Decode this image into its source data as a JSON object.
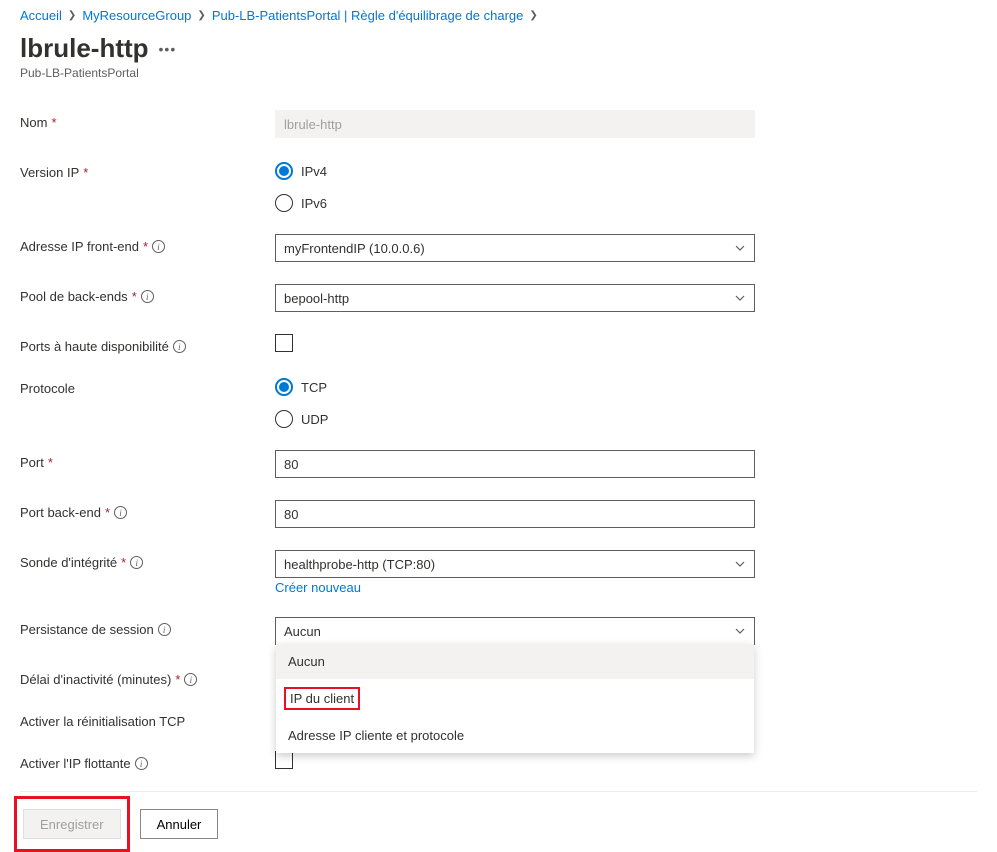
{
  "breadcrumb": {
    "items": [
      "Accueil",
      "MyResourceGroup",
      "Pub-LB-PatientsPortal | Règle d'équilibrage de charge"
    ]
  },
  "header": {
    "title": "lbrule-http",
    "subtitle": "Pub-LB-PatientsPortal"
  },
  "form": {
    "name": {
      "label": "Nom",
      "value": "lbrule-http"
    },
    "ipVersion": {
      "label": "Version IP",
      "options": {
        "v4": "IPv4",
        "v6": "IPv6"
      },
      "selected": "v4"
    },
    "frontend": {
      "label": "Adresse IP front-end",
      "value": "myFrontendIP (10.0.0.6)"
    },
    "backendPool": {
      "label": "Pool de back-ends",
      "value": "bepool-http"
    },
    "haPorts": {
      "label": "Ports à haute disponibilité"
    },
    "protocol": {
      "label": "Protocole",
      "options": {
        "tcp": "TCP",
        "udp": "UDP"
      },
      "selected": "tcp"
    },
    "port": {
      "label": "Port",
      "value": "80"
    },
    "backendPort": {
      "label": "Port back-end",
      "value": "80"
    },
    "healthProbe": {
      "label": "Sonde d'intégrité",
      "value": "healthprobe-http (TCP:80)",
      "createNew": "Créer nouveau"
    },
    "sessionPersistence": {
      "label": "Persistance de session",
      "value": "Aucun",
      "options": [
        "Aucun",
        "IP du client",
        "Adresse IP cliente et protocole"
      ]
    },
    "idleTimeout": {
      "label": "Délai d'inactivité (minutes)"
    },
    "tcpReset": {
      "label": "Activer la réinitialisation TCP"
    },
    "floatingIp": {
      "label": "Activer l'IP flottante"
    }
  },
  "footer": {
    "save": "Enregistrer",
    "cancel": "Annuler"
  }
}
